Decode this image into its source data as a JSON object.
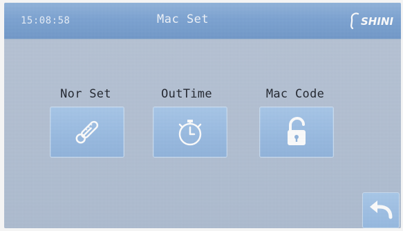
{
  "header": {
    "clock": "15:08:58",
    "title": "Mac Set",
    "logo_text": "SHINI"
  },
  "menu": [
    {
      "label": "Nor Set",
      "icon": "thermometer-icon"
    },
    {
      "label": "OutTime",
      "icon": "stopwatch-icon"
    },
    {
      "label": "Mac Code",
      "icon": "unlock-icon"
    }
  ],
  "footer": {
    "back_icon": "return-arrow-icon"
  },
  "colors": {
    "header_bar": "#7aa2d3",
    "background": "#b3c1d4",
    "button": "#98bbe3",
    "icon": "#ffffff"
  }
}
